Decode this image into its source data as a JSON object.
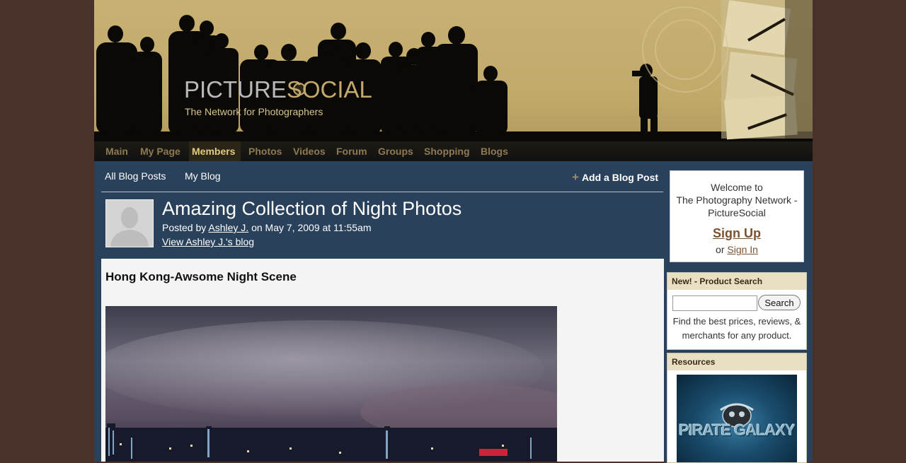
{
  "site": {
    "logo_part1": "PICTURE",
    "logo_part2": "SOCIAL",
    "tagline": "The Network for Photographers"
  },
  "nav": {
    "items": [
      {
        "label": "Main"
      },
      {
        "label": "My Page"
      },
      {
        "label": "Members",
        "active": true
      },
      {
        "label": "Photos"
      },
      {
        "label": "Videos"
      },
      {
        "label": "Forum"
      },
      {
        "label": "Groups"
      },
      {
        "label": "Shopping"
      },
      {
        "label": "Blogs"
      }
    ]
  },
  "subnav": {
    "all_posts": "All Blog Posts",
    "my_blog": "My Blog",
    "add_post": "Add a Blog Post",
    "add_icon": "+"
  },
  "post": {
    "title": "Amazing Collection of Night Photos",
    "posted_by_prefix": "Posted by ",
    "author": "Ashley J.",
    "date_text": " on May 7, 2009 at 11:55am",
    "view_blog": "View Ashley J.'s blog",
    "heading": "Hong Kong-Awsome Night Scene"
  },
  "sidebar": {
    "welcome_line1": "Welcome to",
    "welcome_line2": "The Photography Network -",
    "welcome_line3": "PictureSocial",
    "signup": "Sign Up",
    "or": "or ",
    "signin": "Sign In",
    "product_search": {
      "header": "New! - Product Search",
      "input_value": "",
      "button": "Search",
      "description": "Find the best prices, reviews, & merchants for any product."
    },
    "resources": {
      "header": "Resources",
      "ad_text": "PIRATE GALAXY"
    }
  },
  "colors": {
    "page_bg": "#4a322b",
    "panel_bg": "#29415a",
    "header_gold": "#c7b173",
    "nav_active": "#e4cc7c",
    "link_brown": "#7a5230"
  }
}
